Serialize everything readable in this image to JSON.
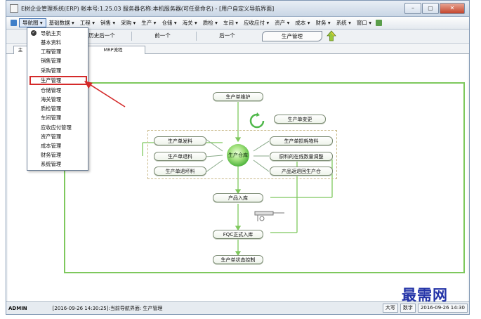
{
  "window": {
    "title": "E树企业管理系统(ERP) 帐本号:1.25.03 服务器名称:本机服务器(可任意命名) - [用户自定义导航界面]",
    "controls": {
      "minimize": "–",
      "maximize": "▢",
      "close": "✕"
    }
  },
  "menubar": {
    "items": [
      "导航图 ▾",
      "基础数据 ▾",
      "工程 ▾",
      "销售 ▾",
      "采购 ▾",
      "生产 ▾",
      "仓储 ▾",
      "海关 ▾",
      "质检 ▾",
      "车间 ▾",
      "应收应付 ▾",
      "资产 ▾",
      "成本 ▾",
      "财务 ▾",
      "系统 ▾",
      "窗口 ▾"
    ]
  },
  "toolbar": {
    "history_back": "历史后一个",
    "prev": "前一个",
    "next": "后一个",
    "current": "生产管理"
  },
  "tabs": {
    "first": "主",
    "second": "MRP流程"
  },
  "dropdown": {
    "items": [
      "导航主页",
      "基本资料",
      "工程管理",
      "销售管理",
      "采购管理",
      "生产管理",
      "仓储管理",
      "海关管理",
      "质检管理",
      "车间管理",
      "应收应付管理",
      "资产管理",
      "成本管理",
      "财务管理",
      "系统管理"
    ],
    "checked": "导航主页",
    "highlighted": "生产管理"
  },
  "flow": {
    "maintain": "生产单维护",
    "change": "生产单变更",
    "issue": "生产单发料",
    "return_material": "生产单退料",
    "return_scrap": "生产单退坏料",
    "warehouse": "生产仓库",
    "loss": "生产单损耗物料",
    "online_adjust": "原料的在线数量调整",
    "product_return": "产品返退回生产仓",
    "product_in": "产品入库",
    "fqc": "FQC正式入库",
    "status": "生产单状态控制"
  },
  "statusbar": {
    "user": "ADMIN",
    "message": "[2016-09-26 14:30:25]:当前导航界面: 生产管理",
    "caps": "大写",
    "num": "数字",
    "datetime": "2016-09-26 14:30"
  },
  "watermark": "最需网",
  "colors": {
    "flow_border": "#7ec85d",
    "highlight": "#d42a2a",
    "arrow": "#d42a2a"
  }
}
